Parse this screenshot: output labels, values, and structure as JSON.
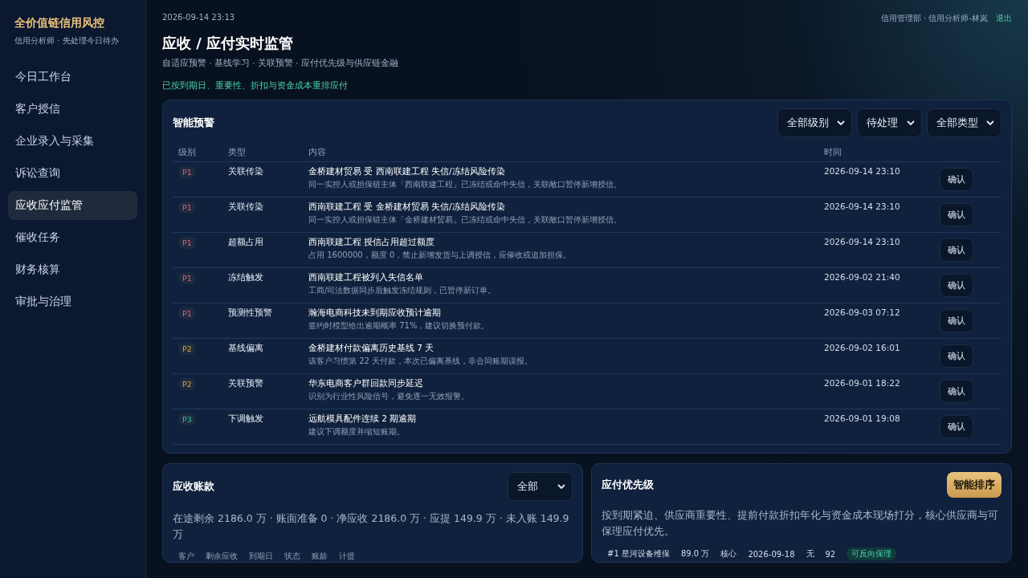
{
  "sidebar": {
    "brand": "全价值链信用风控",
    "subtitle": "信用分析师 · 先处理今日待办",
    "items": [
      {
        "label": "今日工作台",
        "selected": false
      },
      {
        "label": "客户授信",
        "selected": false
      },
      {
        "label": "企业录入与采集",
        "selected": false
      },
      {
        "label": "诉讼查询",
        "selected": false
      },
      {
        "label": "应收应付监管",
        "selected": true
      },
      {
        "label": "催收任务",
        "selected": false
      },
      {
        "label": "财务核算",
        "selected": false
      },
      {
        "label": "审批与治理",
        "selected": false
      }
    ]
  },
  "header": {
    "timestamp": "2026-09-14 23:13",
    "title": "应收 / 应付实时监管",
    "subtitle": "自适应预警 · 基线学习 · 关联预警 · 应付优先级与供应链金融",
    "notice": "已按到期日、重要性、折扣与资金成本重排应付",
    "user": "信用管理部 · 信用分析师-林岚",
    "logout": "退出"
  },
  "alerts": {
    "title": "智能预警",
    "filters": [
      "全部级别",
      "待处理",
      "全部类型"
    ],
    "columns": [
      "级别",
      "类型",
      "内容",
      "时间"
    ],
    "rows": [
      {
        "level": "P1",
        "color": "#e0607a",
        "type": "关联传染",
        "title": "金桥建材贸易 受 西南联建工程 失信/冻结风险传染",
        "detail": "同一实控人或担保链主体「西南联建工程」已冻结或命中失信，关联敞口暂停新增授信。",
        "time": "2026-09-14 23:10",
        "action": "确认"
      },
      {
        "level": "P1",
        "color": "#e0607a",
        "type": "关联传染",
        "title": "西南联建工程 受 金桥建材贸易 失信/冻结风险传染",
        "detail": "同一实控人或担保链主体「金桥建材贸易」已冻结或命中失信，关联敞口暂停新增授信。",
        "time": "2026-09-14 23:10",
        "action": "确认"
      },
      {
        "level": "P1",
        "color": "#e0607a",
        "type": "超额占用",
        "title": "西南联建工程 授信占用超过额度",
        "detail": "占用 1600000，额度 0，禁止新增发货与上调授信，应催收或追加担保。",
        "time": "2026-09-14 23:10",
        "action": "确认"
      },
      {
        "level": "P1",
        "color": "#e0607a",
        "type": "冻结触发",
        "title": "西南联建工程被列入失信名单",
        "detail": "工商/司法数据同步后触发冻结规则，已暂停新订单。",
        "time": "2026-09-02 21:40",
        "action": "确认"
      },
      {
        "level": "P1",
        "color": "#e0607a",
        "type": "预测性预警",
        "title": "瀚海电商科技未到期应收预计逾期",
        "detail": "签约时模型给出逾期概率 71%，建议切换预付款。",
        "time": "2026-09-03 07:12",
        "action": "确认"
      },
      {
        "level": "P2",
        "color": "#d9a441",
        "type": "基线偏离",
        "title": "金桥建材付款偏离历史基线 7 天",
        "detail": "该客户习惯第 22 天付款，本次已偏离基线，非合同账期误报。",
        "time": "2026-09-02 16:01",
        "action": "确认"
      },
      {
        "level": "P2",
        "color": "#d9a441",
        "type": "关联预警",
        "title": "华东电商客户群回款同步延迟",
        "detail": "识别为行业性风险信号，避免逐一无效报警。",
        "time": "2026-09-01 18:22",
        "action": "确认"
      },
      {
        "level": "P3",
        "color": "#3fbf9a",
        "type": "下调触发",
        "title": "远航模具配件连续 2 期逾期",
        "detail": "建议下调额度并缩短账期。",
        "time": "2026-09-01 19:08",
        "action": "确认"
      }
    ]
  },
  "receivables": {
    "title": "应收账款",
    "filter": "全部",
    "summary": "在途剩余 2186.0 万 · 账面准备 0 · 净应收 2186.0 万 · 应提 149.9 万 · 未入账 149.9 万",
    "columns": [
      "客户",
      "剩余应收",
      "到期日",
      "状态",
      "账龄",
      "计提"
    ]
  },
  "payables": {
    "title": "应付优先级",
    "button": "智能排序",
    "description": "按到期紧迫、供应商重要性、提前付款折扣年化与资金成本现场打分，核心供应商与可保理应付优先。",
    "rows": [
      {
        "name": "#1 星河设备维保",
        "amount": "89.0 万",
        "tier": "核心",
        "due": "2026-09-18",
        "discount": "无",
        "score": "92",
        "tag": "可反向保理"
      }
    ]
  }
}
